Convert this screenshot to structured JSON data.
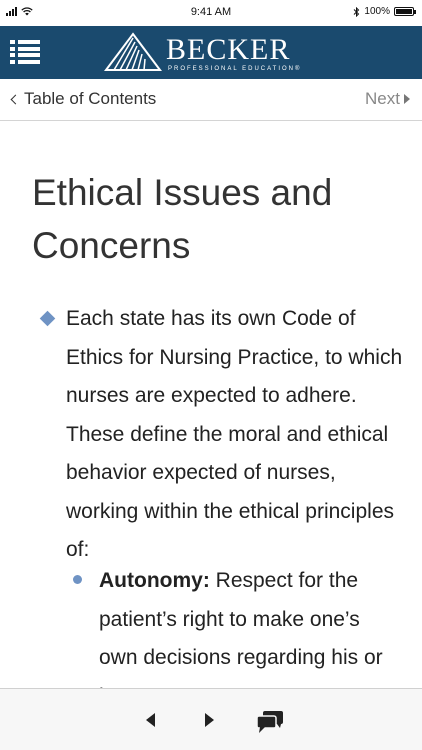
{
  "status_bar": {
    "time": "9:41 AM",
    "battery": "100%"
  },
  "header": {
    "logo_text": "BECKER",
    "logo_tagline": "PROFESSIONAL EDUCATION®",
    "brand_color": "#1a4a6e"
  },
  "nav": {
    "back_label": "Table of Contents",
    "next_label": "Next"
  },
  "content": {
    "title": "Ethical Issues and Concerns",
    "paragraph": "Each state has its own Code of Ethics for Nursing Practice, to which nurses are expected to adhere. These define the moral and ethical behavior expected of nurses, working within the ethical principles of:",
    "sub_items": [
      {
        "term": "Autonomy:",
        "text": " Respect for the patient’s right to make one’s own decisions regarding his or her care."
      }
    ],
    "bullet_color": "#6f93c4"
  },
  "toolbar": {
    "icons": [
      "previous-icon",
      "next-icon",
      "chat-icon"
    ]
  }
}
